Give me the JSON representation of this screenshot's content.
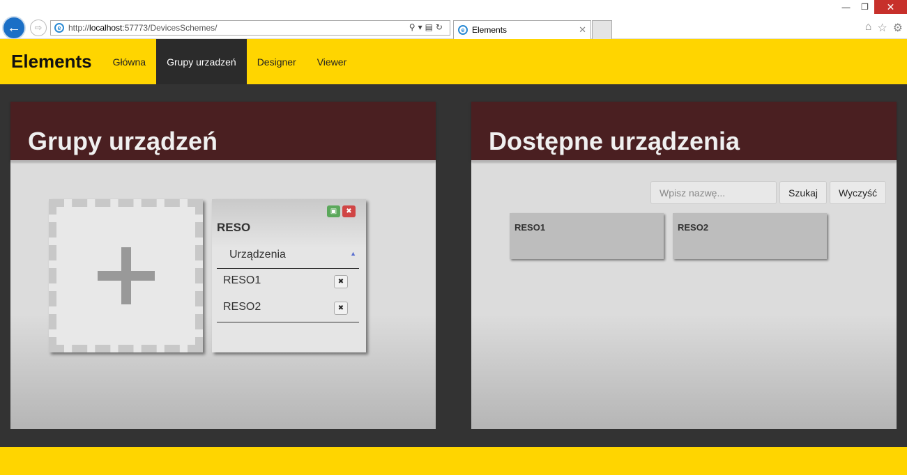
{
  "browser": {
    "url_prefix": "http://",
    "url_host": "localhost",
    "url_rest": ":57773/DevicesSchemes/",
    "tab_title": "Elements"
  },
  "nav": {
    "brand": "Elements",
    "items": [
      {
        "label": "Główna"
      },
      {
        "label": "Grupy urzadzeń"
      },
      {
        "label": "Designer"
      },
      {
        "label": "Viewer"
      }
    ],
    "active_index": 1
  },
  "groups_panel": {
    "title": "Grupy urządzeń",
    "group": {
      "name": "RESO",
      "section_label": "Urządzenia",
      "devices": [
        "RESO1",
        "RESO2"
      ]
    }
  },
  "devices_panel": {
    "title": "Dostępne urządzenia",
    "search_placeholder": "Wpisz nazwę...",
    "search_button": "Szukaj",
    "clear_button": "Wyczyść",
    "devices": [
      "RESO1",
      "RESO2"
    ]
  },
  "colors": {
    "accent": "#ffd500",
    "panel_header": "#4a1f21",
    "background": "#333333"
  }
}
